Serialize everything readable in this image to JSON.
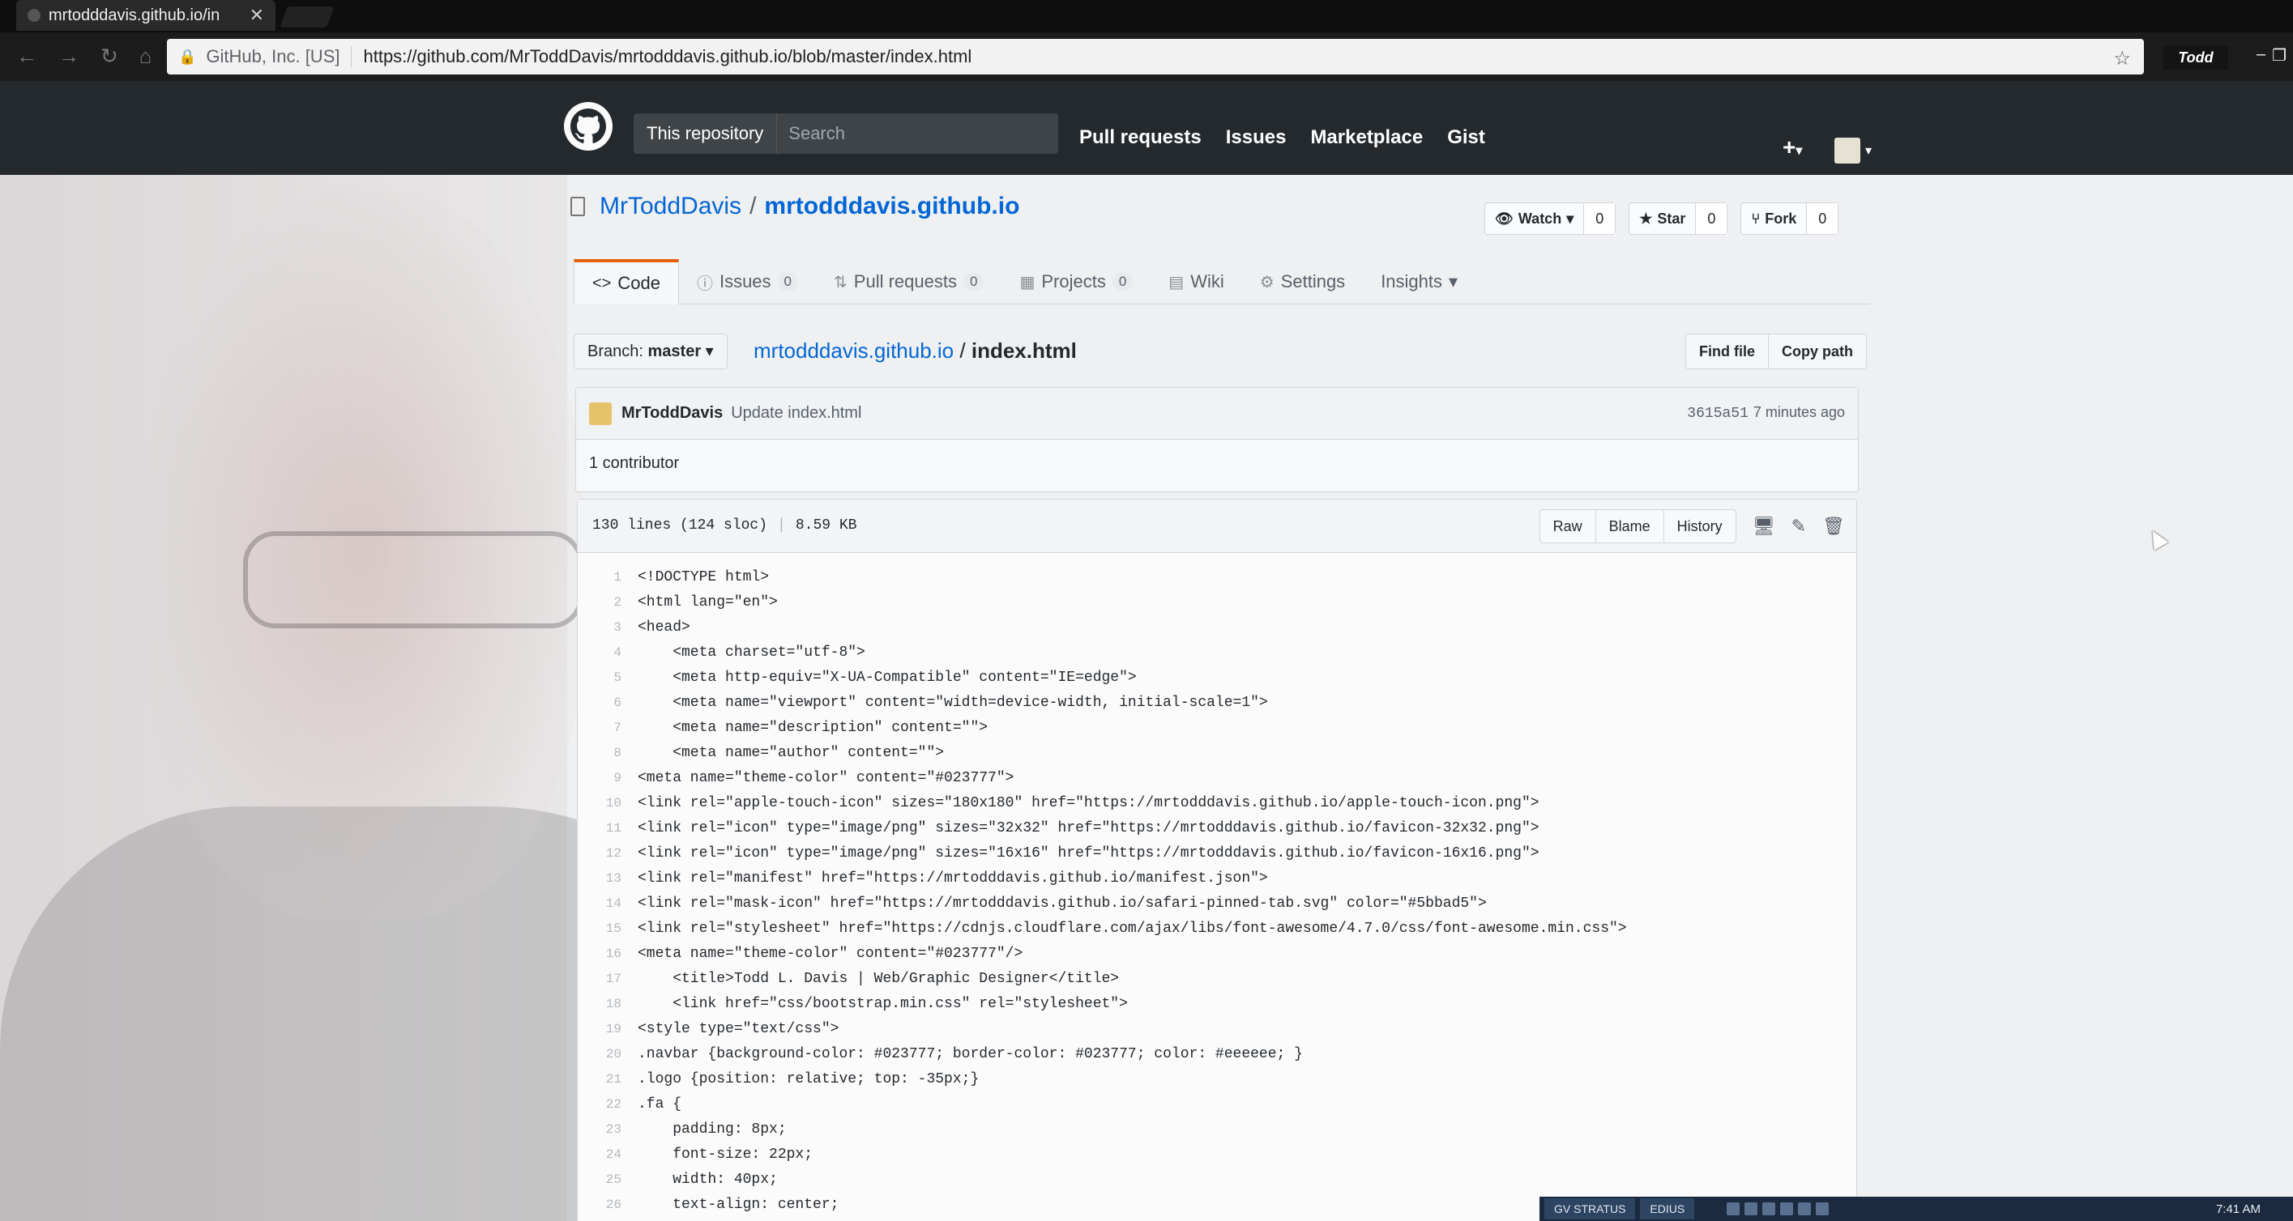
{
  "browser": {
    "tab_title": "mrtodddavis.github.io/in",
    "security_label": "GitHub, Inc. [US]",
    "url": "https://github.com/MrToddDavis/mrtodddavis.github.io/blob/master/index.html",
    "profile_name": "Todd"
  },
  "github_header": {
    "scope_label": "This repository",
    "search_placeholder": "Search",
    "nav": [
      "Pull requests",
      "Issues",
      "Marketplace",
      "Gist"
    ],
    "new_label": "+",
    "new_caret": "▾"
  },
  "repo": {
    "owner": "MrToddDavis",
    "separator": "/",
    "name": "mrtodddavis.github.io",
    "watch_label": "Watch",
    "watch_count": "0",
    "star_label": "Star",
    "star_count": "0",
    "fork_label": "Fork",
    "fork_count": "0"
  },
  "repo_tabs": [
    {
      "label": "Code",
      "icon": "code-icon"
    },
    {
      "label": "Issues",
      "count": "0",
      "icon": "issue-icon"
    },
    {
      "label": "Pull requests",
      "count": "0",
      "icon": "pull-request-icon"
    },
    {
      "label": "Projects",
      "count": "0",
      "icon": "project-icon"
    },
    {
      "label": "Wiki",
      "icon": "book-icon"
    },
    {
      "label": "Settings",
      "icon": "gear-icon"
    },
    {
      "label": "Insights",
      "caret": "▾"
    }
  ],
  "file_nav": {
    "branch_prefix": "Branch:",
    "branch_name": "master",
    "breadcrumb_repo": "mrtodddavis.github.io",
    "breadcrumb_sep": "/",
    "breadcrumb_file": "index.html",
    "find_file": "Find file",
    "copy_path": "Copy path"
  },
  "commit": {
    "author": "MrToddDavis",
    "message": "Update index.html",
    "sha": "3615a51",
    "time": "7 minutes ago",
    "contributors": "1 contributor"
  },
  "file": {
    "lines_info": "130 lines (124 sloc)",
    "size": "8.59 KB",
    "raw": "Raw",
    "blame": "Blame",
    "history": "History"
  },
  "code_lines": [
    {
      "n": "1",
      "t": "<!DOCTYPE html>"
    },
    {
      "n": "2",
      "t": "<html lang=\"en\">"
    },
    {
      "n": "3",
      "t": "<head>"
    },
    {
      "n": "4",
      "t": "    <meta charset=\"utf-8\">"
    },
    {
      "n": "5",
      "t": "    <meta http-equiv=\"X-UA-Compatible\" content=\"IE=edge\">"
    },
    {
      "n": "6",
      "t": "    <meta name=\"viewport\" content=\"width=device-width, initial-scale=1\">"
    },
    {
      "n": "7",
      "t": "    <meta name=\"description\" content=\"\">"
    },
    {
      "n": "8",
      "t": "    <meta name=\"author\" content=\"\">"
    },
    {
      "n": "9",
      "t": "<meta name=\"theme-color\" content=\"#023777\">"
    },
    {
      "n": "10",
      "t": "<link rel=\"apple-touch-icon\" sizes=\"180x180\" href=\"https://mrtodddavis.github.io/apple-touch-icon.png\">"
    },
    {
      "n": "11",
      "t": "<link rel=\"icon\" type=\"image/png\" sizes=\"32x32\" href=\"https://mrtodddavis.github.io/favicon-32x32.png\">"
    },
    {
      "n": "12",
      "t": "<link rel=\"icon\" type=\"image/png\" sizes=\"16x16\" href=\"https://mrtodddavis.github.io/favicon-16x16.png\">"
    },
    {
      "n": "13",
      "t": "<link rel=\"manifest\" href=\"https://mrtodddavis.github.io/manifest.json\">"
    },
    {
      "n": "14",
      "t": "<link rel=\"mask-icon\" href=\"https://mrtodddavis.github.io/safari-pinned-tab.svg\" color=\"#5bbad5\">"
    },
    {
      "n": "15",
      "t": "<link rel=\"stylesheet\" href=\"https://cdnjs.cloudflare.com/ajax/libs/font-awesome/4.7.0/css/font-awesome.min.css\">"
    },
    {
      "n": "16",
      "t": "<meta name=\"theme-color\" content=\"#023777\"/>"
    },
    {
      "n": "17",
      "t": "    <title>Todd L. Davis | Web/Graphic Designer</title>"
    },
    {
      "n": "18",
      "t": "    <link href=\"css/bootstrap.min.css\" rel=\"stylesheet\">"
    },
    {
      "n": "19",
      "t": "<style type=\"text/css\">"
    },
    {
      "n": "20",
      "t": ".navbar {background-color: #023777; border-color: #023777; color: #eeeeee; }"
    },
    {
      "n": "21",
      "t": ".logo {position: relative; top: -35px;}"
    },
    {
      "n": "22",
      "t": ".fa {"
    },
    {
      "n": "23",
      "t": "    padding: 8px;"
    },
    {
      "n": "24",
      "t": "    font-size: 22px;"
    },
    {
      "n": "25",
      "t": "    width: 40px;"
    },
    {
      "n": "26",
      "t": "    text-align: center;"
    }
  ],
  "taskbar": {
    "items": [
      "GV STRATUS",
      "EDIUS"
    ],
    "clock": "7:41 AM"
  },
  "colors": {
    "github_header": "#24292e",
    "link_blue": "#0366d6",
    "selected_tab_accent": "#e36209"
  }
}
